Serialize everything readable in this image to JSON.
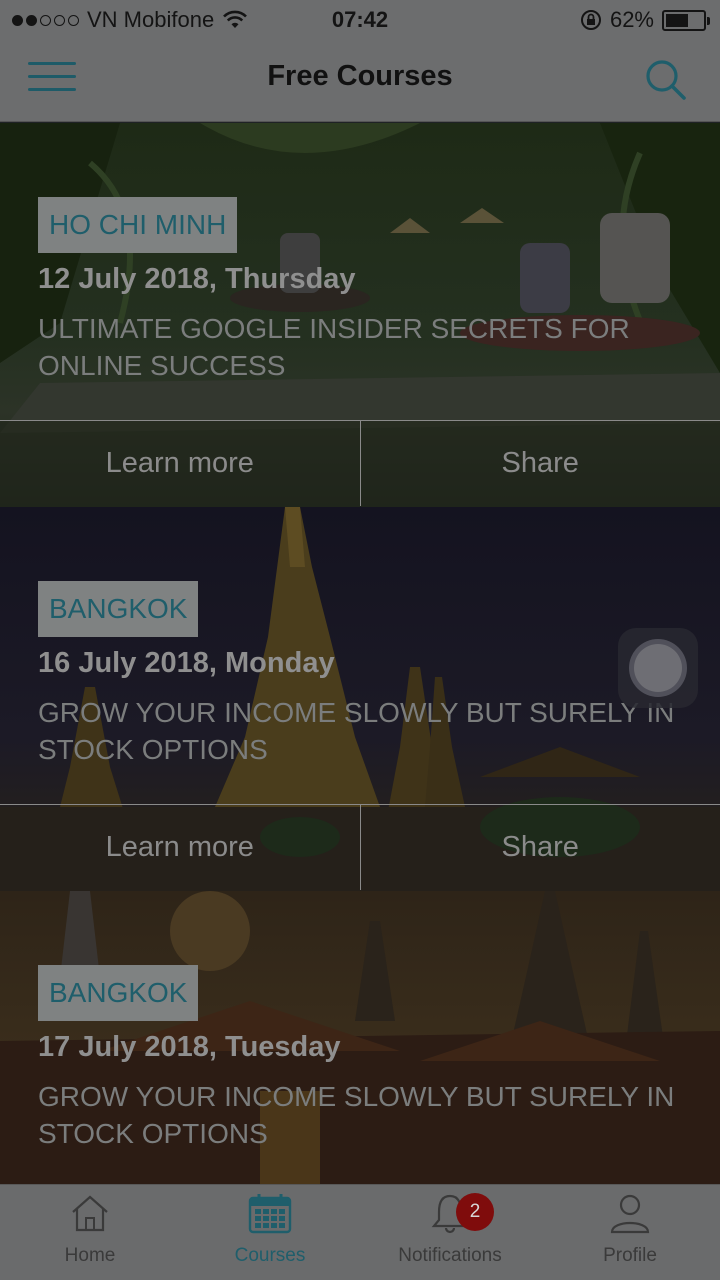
{
  "status_bar": {
    "carrier": "VN Mobifone",
    "time": "07:42",
    "battery": "62%",
    "battery_level": 0.62,
    "signal_bars": 2,
    "icons": [
      "wifi-icon",
      "rotation-lock-icon",
      "battery-icon"
    ]
  },
  "header": {
    "title": "Free Courses",
    "menu_icon": "hamburger-menu-icon",
    "search_icon": "search-icon",
    "accent_color": "#1f5e6b"
  },
  "courses": [
    {
      "city": "HO CHI MINH",
      "date": "12 July 2018, Thursday",
      "title": "ULTIMATE GOOGLE INSIDER SECRETS FOR ONLINE SUCCESS",
      "learn_more": "Learn more",
      "share": "Share"
    },
    {
      "city": "BANGKOK",
      "date": "16 July 2018, Monday",
      "title": "GROW YOUR INCOME SLOWLY BUT SURELY IN STOCK OPTIONS",
      "learn_more": "Learn more",
      "share": "Share"
    },
    {
      "city": "BANGKOK",
      "date": "17 July 2018, Tuesday",
      "title": "GROW YOUR INCOME SLOWLY BUT SURELY IN STOCK OPTIONS"
    }
  ],
  "tab_bar": {
    "tabs": [
      {
        "label": "Home",
        "icon": "home-icon"
      },
      {
        "label": "Courses",
        "icon": "calendar-icon",
        "active": true
      },
      {
        "label": "Notifications",
        "icon": "bell-icon",
        "badge": "2"
      },
      {
        "label": "Profile",
        "icon": "person-icon"
      }
    ]
  },
  "colors": {
    "overlay": "#000000",
    "badge_red": "#7f0c0c",
    "tab_active": "#1f5e6b"
  }
}
